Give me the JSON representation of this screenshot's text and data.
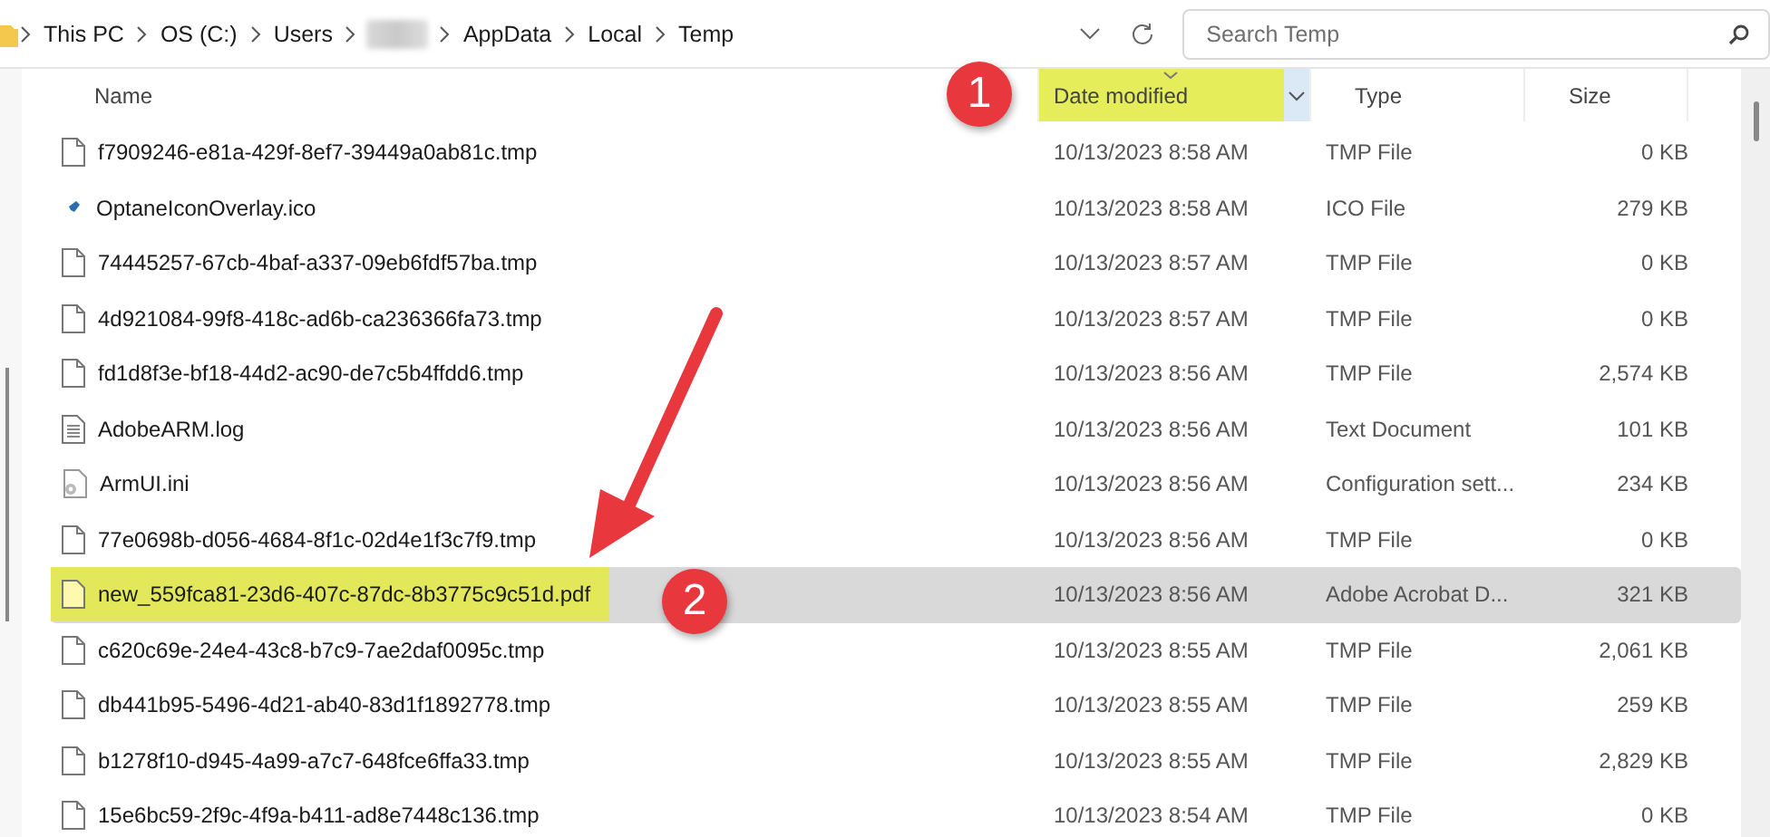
{
  "address_bar": {
    "crumbs": [
      {
        "kind": "text",
        "label": "This PC"
      },
      {
        "kind": "text",
        "label": "OS (C:)"
      },
      {
        "kind": "text",
        "label": "Users"
      },
      {
        "kind": "redacted"
      },
      {
        "kind": "text",
        "label": "AppData"
      },
      {
        "kind": "text",
        "label": "Local"
      },
      {
        "kind": "text",
        "label": "Temp"
      }
    ]
  },
  "search": {
    "placeholder": "Search Temp"
  },
  "columns": [
    {
      "label": "Name",
      "sorted": false,
      "highlighted": false
    },
    {
      "label": "Date modified",
      "sorted": true,
      "highlighted": true
    },
    {
      "label": "Type",
      "sorted": false,
      "highlighted": false
    },
    {
      "label": "Size",
      "sorted": false,
      "highlighted": false
    }
  ],
  "rows": [
    {
      "kind": "file",
      "name": "f7909246-e81a-429f-8ef7-39449a0ab81c.tmp",
      "date": "10/13/2023 8:58 AM",
      "type": "TMP File",
      "size": "0 KB",
      "selected": false,
      "highlighted": false
    },
    {
      "kind": "ico",
      "name": "OptaneIconOverlay.ico",
      "date": "10/13/2023 8:58 AM",
      "type": "ICO File",
      "size": "279 KB",
      "selected": false,
      "highlighted": false
    },
    {
      "kind": "file",
      "name": "74445257-67cb-4baf-a337-09eb6fdf57ba.tmp",
      "date": "10/13/2023 8:57 AM",
      "type": "TMP File",
      "size": "0 KB",
      "selected": false,
      "highlighted": false
    },
    {
      "kind": "file",
      "name": "4d921084-99f8-418c-ad6b-ca236366fa73.tmp",
      "date": "10/13/2023 8:57 AM",
      "type": "TMP File",
      "size": "0 KB",
      "selected": false,
      "highlighted": false
    },
    {
      "kind": "file",
      "name": "fd1d8f3e-bf18-44d2-ac90-de7c5b4ffdd6.tmp",
      "date": "10/13/2023 8:56 AM",
      "type": "TMP File",
      "size": "2,574 KB",
      "selected": false,
      "highlighted": false
    },
    {
      "kind": "log",
      "name": "AdobeARM.log",
      "date": "10/13/2023 8:56 AM",
      "type": "Text Document",
      "size": "101 KB",
      "selected": false,
      "highlighted": false
    },
    {
      "kind": "ini",
      "name": "ArmUI.ini",
      "date": "10/13/2023 8:56 AM",
      "type": "Configuration sett...",
      "size": "234 KB",
      "selected": false,
      "highlighted": false
    },
    {
      "kind": "file",
      "name": "77e0698b-d056-4684-8f1c-02d4e1f3c7f9.tmp",
      "date": "10/13/2023 8:56 AM",
      "type": "TMP File",
      "size": "0 KB",
      "selected": false,
      "highlighted": false
    },
    {
      "kind": "pdf",
      "name": "new_559fca81-23d6-407c-87dc-8b3775c9c51d.pdf",
      "date": "10/13/2023 8:56 AM",
      "type": "Adobe Acrobat D...",
      "size": "321 KB",
      "selected": true,
      "highlighted": true
    },
    {
      "kind": "file",
      "name": "c620c69e-24e4-43c8-b7c9-7ae2daf0095c.tmp",
      "date": "10/13/2023 8:55 AM",
      "type": "TMP File",
      "size": "2,061 KB",
      "selected": false,
      "highlighted": false
    },
    {
      "kind": "file",
      "name": "db441b95-5496-4d21-ab40-83d1f1892778.tmp",
      "date": "10/13/2023 8:55 AM",
      "type": "TMP File",
      "size": "259 KB",
      "selected": false,
      "highlighted": false
    },
    {
      "kind": "file",
      "name": "b1278f10-d945-4a99-a7c7-648fce6ffa33.tmp",
      "date": "10/13/2023 8:55 AM",
      "type": "TMP File",
      "size": "2,829 KB",
      "selected": false,
      "highlighted": false
    },
    {
      "kind": "file",
      "name": "15e6bc59-2f9c-4f9a-b411-ad8e7448c136.tmp",
      "date": "10/13/2023 8:54 AM",
      "type": "TMP File",
      "size": "0 KB",
      "selected": false,
      "highlighted": false
    }
  ],
  "annotations": [
    {
      "label": "1"
    },
    {
      "label": "2"
    }
  ]
}
